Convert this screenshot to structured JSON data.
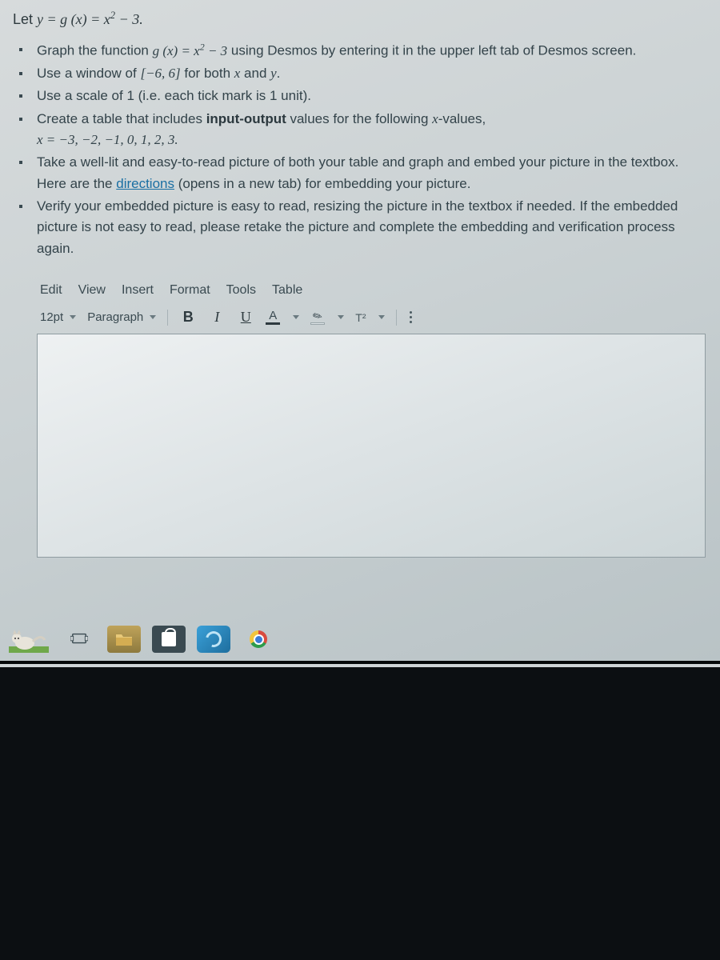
{
  "intro": {
    "prefix": "Let ",
    "eq_lhs": "y = g (x) = x",
    "eq_sup": "2",
    "eq_tail": " − 3."
  },
  "bullets": {
    "b1_a": "Graph the function ",
    "b1_eq_lhs": "g (x) = x",
    "b1_eq_sup": "2",
    "b1_eq_tail": " − 3",
    "b1_b": " using Desmos by entering it in the upper left tab of Desmos screen.",
    "b2_a": "Use a window of ",
    "b2_interval": "[−6, 6]",
    "b2_b": " for both ",
    "b2_x": "x",
    "b2_and": " and ",
    "b2_y": "y",
    "b2_c": ".",
    "b3": "Use a scale of 1 (i.e. each tick mark is 1 unit).",
    "b4_a": "Create a table that includes ",
    "b4_bold": "input-output",
    "b4_b": " values for the following ",
    "b4_x": "x",
    "b4_c": "-values,",
    "b4_line2_a": "x",
    "b4_line2_b": " = −3, −2, −1, 0, 1, 2, 3.",
    "b5_a": "Take a well-lit and easy-to-read picture of both your table and graph and embed your picture in the textbox. Here are the ",
    "b5_link": "directions",
    "b5_b": " (opens in a new tab) for embedding your picture.",
    "b6": "Verify your embedded picture is easy to read, resizing the picture in the textbox if needed. If the embedded picture is not easy to read, please retake the picture and complete the embedding and verification process again."
  },
  "menubar": {
    "edit": "Edit",
    "view": "View",
    "insert": "Insert",
    "format": "Format",
    "tools": "Tools",
    "table": "Table"
  },
  "toolbar": {
    "font_size": "12pt",
    "para": "Paragraph",
    "bold": "B",
    "italic": "I",
    "underline": "U",
    "textcolor_glyph": "A",
    "highlight_glyph": "✎",
    "superscript": "T²",
    "more_aria": "More options"
  },
  "taskbar": {
    "taskview": "task-view",
    "explorer": "file-explorer",
    "store": "microsoft-store",
    "edge": "edge-browser",
    "chrome": "chrome-browser"
  }
}
